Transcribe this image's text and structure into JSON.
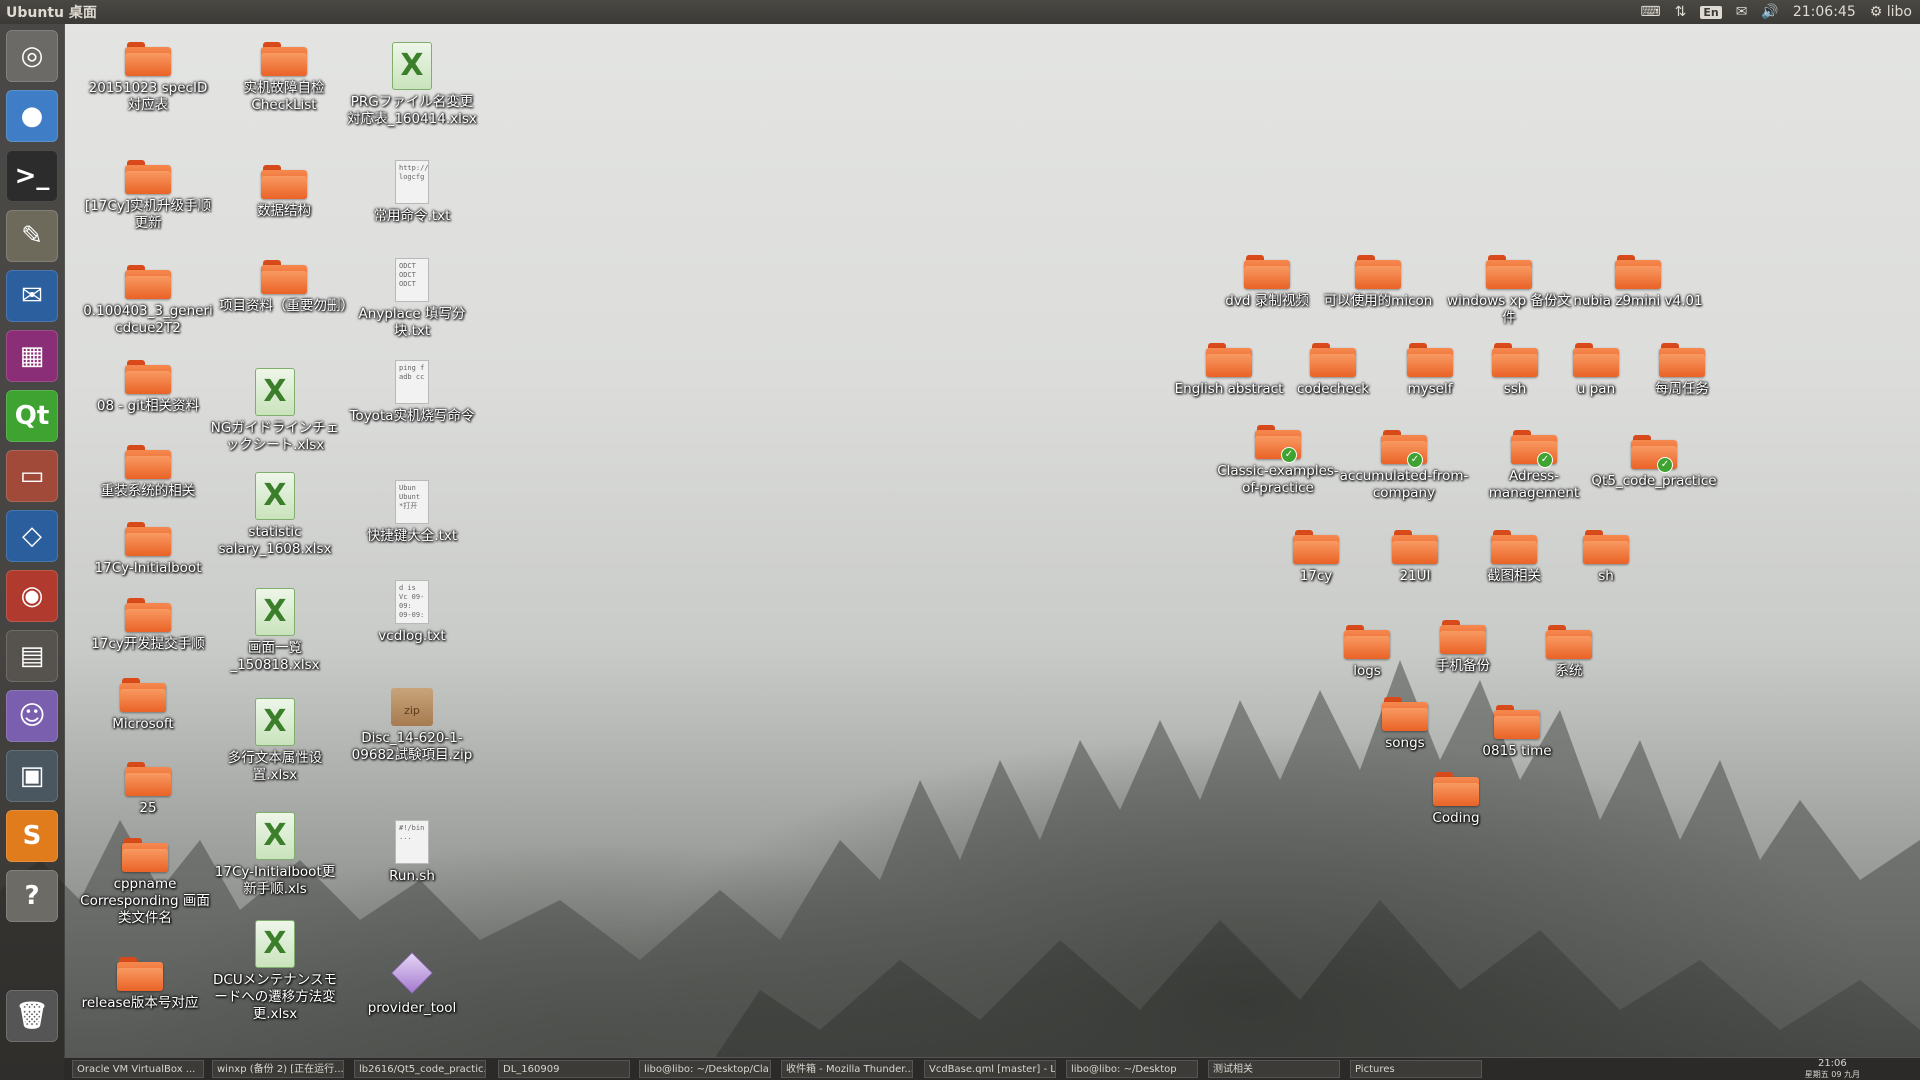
{
  "top_panel": {
    "title": "Ubuntu 桌面",
    "language": "En",
    "clock": "21:06:45",
    "user": "libo",
    "icons": [
      "keyboard-icon",
      "network-icon",
      "mail-icon",
      "volume-icon",
      "gear-icon"
    ]
  },
  "launcher": {
    "items": [
      {
        "name": "dash-home",
        "glyph": "◎",
        "color": "#6b6a66"
      },
      {
        "name": "chromium",
        "glyph": "●",
        "color": "#3f7dc6"
      },
      {
        "name": "terminal",
        "glyph": ">_",
        "color": "#2c2c2c"
      },
      {
        "name": "gimp",
        "glyph": "✎",
        "color": "#6d6a5c"
      },
      {
        "name": "thunderbird",
        "glyph": "✉",
        "color": "#2c5f9e"
      },
      {
        "name": "workspace-switcher",
        "glyph": "▦",
        "color": "#8a2f77"
      },
      {
        "name": "qt-creator",
        "glyph": "Qt",
        "color": "#3ea330"
      },
      {
        "name": "files",
        "glyph": "▭",
        "color": "#a24a3a"
      },
      {
        "name": "virtualbox",
        "glyph": "◇",
        "color": "#2a5e9c"
      },
      {
        "name": "disk-utility",
        "glyph": "◉",
        "color": "#b03a2e"
      },
      {
        "name": "calculator",
        "glyph": "▤",
        "color": "#56534e"
      },
      {
        "name": "pidgin",
        "glyph": "☺",
        "color": "#7a5fae"
      },
      {
        "name": "remote-desktop",
        "glyph": "▣",
        "color": "#4a5660"
      },
      {
        "name": "sublime-text",
        "glyph": "S",
        "color": "#e07c1c"
      },
      {
        "name": "help",
        "glyph": "?",
        "color": "#6d6b66"
      },
      {
        "name": "trash",
        "glyph": "🗑",
        "color": "#555"
      }
    ]
  },
  "desktop": {
    "left_column1": [
      "20151023 specID対应表",
      "[17Cy]实机升级手顺更新",
      "0.100403_3_genericdcue2T2",
      "08 - git相关资料",
      "重装系统的相关",
      "17Cy-Initialboot",
      "17cy开发提交手顺",
      "Microsoft",
      "25",
      "cppname Corresponding 画面类文件名",
      "release版本号对应"
    ],
    "left_column2_folders": [
      "实机故障自检CheckList",
      "数据结构",
      "项目资料（重要勿删）"
    ],
    "left_column2_xlsx": [
      "NGガイドラインチェックシート.xlsx",
      "statistic salary_1608.xlsx",
      "画面一覧_150818.xlsx",
      "多行文本属性设置.xlsx",
      "17Cy-Initialboot更新手顺.xls",
      "DCUメンテナンスモードへの遷移方法変更.xlsx"
    ],
    "left_column3": [
      {
        "label": "PRGファイル名変更対応表_160414.xlsx",
        "type": "xlsx"
      },
      {
        "label": "常用命令.txt",
        "type": "txt",
        "preview": "http://\nlogcfg"
      },
      {
        "label": "Anyplace 填写分块.txt",
        "type": "txt",
        "preview": "ODCT\nODCT\nODCT"
      },
      {
        "label": "Toyota实机烧写命令",
        "type": "txt",
        "preview": "ping f\nadb cc"
      },
      {
        "label": "快捷键大全.txt",
        "type": "txt",
        "preview": "Ubun\nUbunt\n*打开"
      },
      {
        "label": "vcdlog.txt",
        "type": "txt",
        "preview": "d is Vc\n09-09:\n09-09:"
      },
      {
        "label": "Disc_14-620-1-09682試験項目.zip",
        "type": "zip",
        "preview": "zip"
      },
      {
        "label": "Run.sh",
        "type": "txt",
        "preview": "#!/bin\n..."
      },
      {
        "label": "provider_tool",
        "type": "tool"
      }
    ],
    "right_folders": [
      {
        "label": "dvd 录制视频"
      },
      {
        "label": "可以使用的micon"
      },
      {
        "label": "windows xp 备份文件"
      },
      {
        "label": "nubia z9mini v4.01"
      },
      {
        "label": "English abstract"
      },
      {
        "label": "codecheck"
      },
      {
        "label": "myself"
      },
      {
        "label": "ssh"
      },
      {
        "label": "u pan"
      },
      {
        "label": "每周任务"
      },
      {
        "label": "Classic-examples-of-practice",
        "emblem": true
      },
      {
        "label": "accumulated-from-company",
        "emblem": true
      },
      {
        "label": "Adress-management",
        "emblem": true
      },
      {
        "label": "Qt5_code_practice",
        "emblem": true
      },
      {
        "label": "17cy"
      },
      {
        "label": "21UI"
      },
      {
        "label": "截图相关"
      },
      {
        "label": "sh"
      },
      {
        "label": "logs"
      },
      {
        "label": "手机备份"
      },
      {
        "label": "系统"
      },
      {
        "label": "songs"
      },
      {
        "label": "0815 time"
      },
      {
        "label": "Coding"
      }
    ]
  },
  "taskbar": {
    "tasks": [
      "Oracle VM VirtualBox ...",
      "winxp (备份 2) [正在运行...",
      "lb2616/Qt5_code_practic...",
      "DL_160909",
      "libo@libo: ~/Desktop/Cla...",
      "收件箱 - Mozilla Thunder...",
      "VcdBase.qml [master] - L...",
      "libo@libo: ~/Desktop",
      "测试相关",
      "Pictures"
    ],
    "clock_time": "21:06",
    "clock_date": "星期五 09 九月"
  }
}
